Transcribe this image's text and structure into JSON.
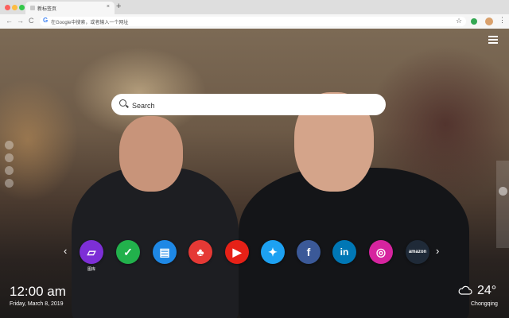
{
  "browser": {
    "tab_title": "新标签页",
    "tab_close": "×",
    "new_tab": "+",
    "address_placeholder": "在Google中搜索，或者输入一个网址",
    "back": "←",
    "forward": "→",
    "reload": "C",
    "star": "☆",
    "menu": "⋮"
  },
  "search": {
    "placeholder": "Search"
  },
  "apps": [
    {
      "name": "gallery",
      "label": "图库",
      "color": "#7d2fd6",
      "glyph": "▱"
    },
    {
      "name": "tasks",
      "label": "",
      "color": "#22b14c",
      "glyph": "✓"
    },
    {
      "name": "notes",
      "label": "",
      "color": "#1e88e5",
      "glyph": "▤"
    },
    {
      "name": "games",
      "label": "",
      "color": "#e53935",
      "glyph": "♣"
    },
    {
      "name": "youtube",
      "label": "",
      "color": "#e62117",
      "glyph": "▶"
    },
    {
      "name": "twitter",
      "label": "",
      "color": "#1da1f2",
      "glyph": "✦"
    },
    {
      "name": "facebook",
      "label": "",
      "color": "#3b5998",
      "glyph": "f"
    },
    {
      "name": "linkedin",
      "label": "",
      "color": "#0077b5",
      "glyph": "in"
    },
    {
      "name": "instagram",
      "label": "",
      "color": "#d6249f",
      "glyph": "◎"
    },
    {
      "name": "amazon",
      "label": "amazon",
      "color": "#1f2a38",
      "glyph": ""
    }
  ],
  "nav": {
    "prev": "‹",
    "next": "›"
  },
  "clock": {
    "time": "12:00 am",
    "date": "Friday, March 8, 2019"
  },
  "weather": {
    "temp": "24°",
    "city": "Chongqing"
  }
}
